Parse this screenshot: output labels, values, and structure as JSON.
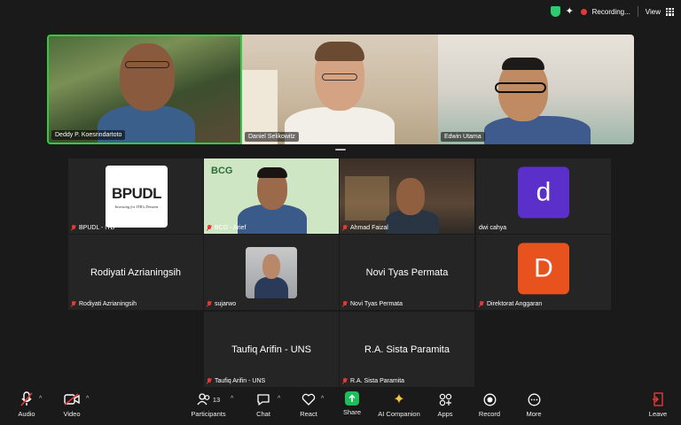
{
  "status": {
    "recording_label": "Recording...",
    "view_label": "View"
  },
  "speakers": [
    {
      "name": "Deddy P. Koesrindartoto"
    },
    {
      "name": "Daniel Selikowitz"
    },
    {
      "name": "Edwin Utama"
    }
  ],
  "gallery": [
    {
      "name": "BPUDL  - ITB",
      "logo_text": "BPUDL",
      "logo_sub": "Investing for ITB's Dreams"
    },
    {
      "name": "BCG - Arief",
      "bg_text": "BCG"
    },
    {
      "name": "Ahmad Faizal"
    },
    {
      "name": "dwi cahya",
      "avatar_letter": "d",
      "avatar_color": "#5b2fc9"
    },
    {
      "name": "Rodiyati Azrianingsih",
      "center_name": "Rodiyati Azrianingsih"
    },
    {
      "name": "sujarwo"
    },
    {
      "name": "Novi Tyas Permata",
      "center_name": "Novi Tyas Permata"
    },
    {
      "name": "Direktorat Anggaran",
      "avatar_letter": "D",
      "avatar_color": "#e8521f"
    },
    {
      "name": "Taufiq Arifin - UNS",
      "center_name": "Taufiq Arifin - UNS"
    },
    {
      "name": "R.A. Sista Paramita",
      "center_name": "R.A. Sista Paramita"
    }
  ],
  "toolbar": {
    "audio": "Audio",
    "video": "Video",
    "participants": "Participants",
    "participants_count": "13",
    "chat": "Chat",
    "react": "React",
    "share": "Share",
    "ai_companion": "AI Companion",
    "apps": "Apps",
    "record": "Record",
    "more": "More",
    "leave": "Leave"
  },
  "colors": {
    "active_speaker_border": "#2ecc40",
    "mute_red": "#e53935",
    "share_green": "#1fbd5a"
  }
}
